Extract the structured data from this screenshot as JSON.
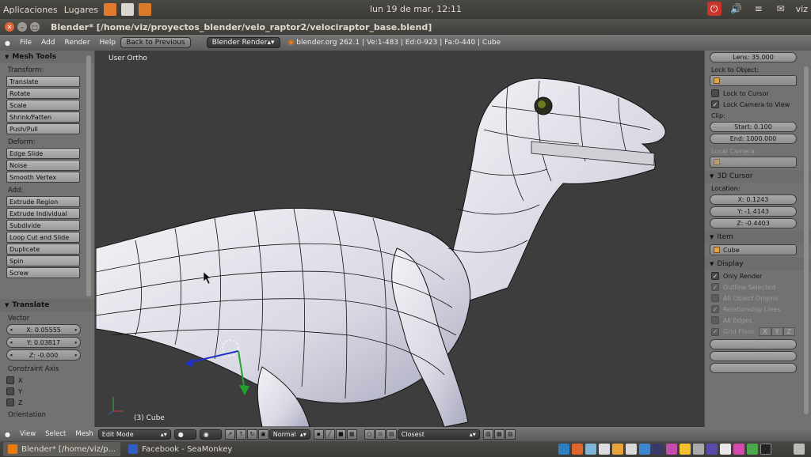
{
  "top_panel": {
    "menus": [
      "Aplicaciones",
      "Lugares"
    ],
    "clock": "lun 19 de mar, 12:11",
    "user": "viz"
  },
  "window": {
    "title": "Blender* [/home/viz/proyectos_blender/velo_raptor2/velociraptor_base.blend]"
  },
  "info_header": {
    "menus": [
      "File",
      "Add",
      "Render",
      "Help"
    ],
    "back_button": "Back to Previous",
    "render_engine": "Blender Render",
    "stats": "blender.org 262.1 | Ve:1-483 | Ed:0-923 | Fa:0-440 | Cube"
  },
  "tool_shelf": {
    "title": "Mesh Tools",
    "transform_label": "Transform:",
    "transform_tools": [
      "Translate",
      "Rotate",
      "Scale",
      "Shrink/Fatten",
      "Push/Pull"
    ],
    "deform_label": "Deform:",
    "deform_tools": [
      "Edge Slide",
      "Noise",
      "Smooth Vertex"
    ],
    "add_label": "Add:",
    "add_tools": [
      "Extrude Region",
      "Extrude Individual",
      "Subdivide",
      "Loop Cut and Slide",
      "Duplicate",
      "Spin",
      "Screw"
    ]
  },
  "operator_panel": {
    "title": "Translate",
    "vector_label": "Vector",
    "vector": [
      "X: 0.05555",
      "Y: 0.03817",
      "Z: -0.000"
    ],
    "constraint_label": "Constraint Axis",
    "constraints": [
      "X",
      "Y",
      "Z"
    ],
    "orientation_label": "Orientation"
  },
  "viewport": {
    "view_label": "User Ortho",
    "object_label": "(3) Cube"
  },
  "properties": {
    "lens": "Lens: 35.000",
    "lock_to_object_label": "Lock to Object:",
    "lock_to_cursor": "Lock to Cursor",
    "lock_camera_to_view": "Lock Camera to View",
    "clip_label": "Clip:",
    "clip_start": "Start: 0.100",
    "clip_end": "End: 1000.000",
    "local_camera_label": "Local Camera:",
    "local_camera_value": "Camera",
    "cursor_title": "3D Cursor",
    "location_label": "Location:",
    "cursor_x": "X: 0.1243",
    "cursor_y": "Y: -1.4143",
    "cursor_z": "Z: -0.4403",
    "item_title": "Item",
    "item_name": "Cube",
    "display_title": "Display",
    "only_render": "Only Render",
    "outline_selected": "Outline Selected",
    "all_object_origins": "All Object Origins",
    "relationship_lines": "Relationship Lines",
    "all_edges": "All Edges",
    "grid_floor": "Grid Floor",
    "grid_axes": [
      "X",
      "Y",
      "Z"
    ],
    "lines": "Lines: 16",
    "scale": "Scale: 1.000",
    "subdivisions": "Subdivisions: 10"
  },
  "view_header": {
    "menus": [
      "View",
      "Select",
      "Mesh"
    ],
    "mode": "Edit Mode",
    "pivot": "Normal",
    "snap": "Closest"
  },
  "taskbar": {
    "tasks": [
      "Blender* [/home/viz/p...",
      "Facebook - SeaMonkey"
    ]
  },
  "colors": {
    "panel_gray": "#727272",
    "viewport_bg": "#3d3d3d",
    "ubuntu_panel": "#3c3b37",
    "close_orange": "#e0653b",
    "accent_blue": "#2c7fc1"
  }
}
